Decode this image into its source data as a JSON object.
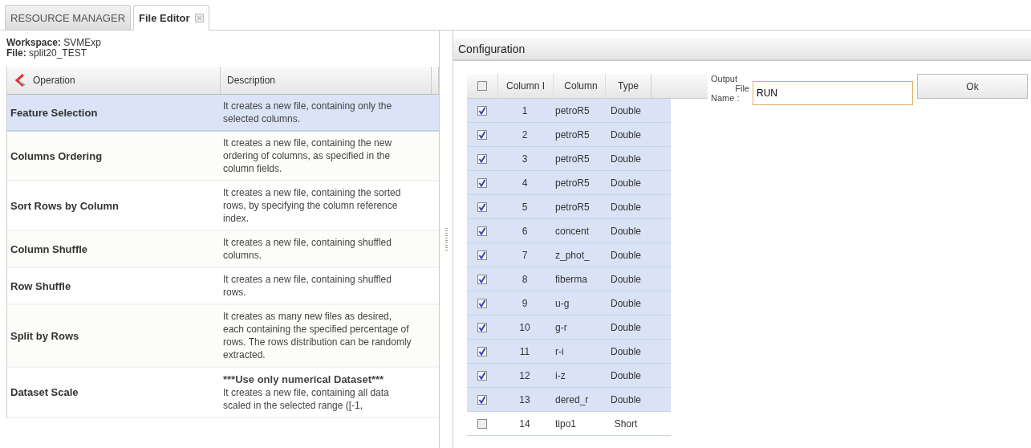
{
  "tabs": [
    {
      "label": "RESOURCE MANAGER",
      "selected": false,
      "closable": false
    },
    {
      "label": "File Editor",
      "selected": true,
      "closable": true
    }
  ],
  "info": [
    {
      "label": "Workspace:",
      "value": "SVMExp"
    },
    {
      "label": "File:",
      "value": "split20_TEST"
    }
  ],
  "operations": {
    "columns": [
      "Operation",
      "Description"
    ],
    "rows": [
      {
        "name": "Feature Selection",
        "description": "It creates a new file, containing only the selected columns.",
        "selected": true
      },
      {
        "name": "Columns Ordering",
        "description": "It creates a new file, containing the new ordering of columns, as specified in the column fields.",
        "selected": false
      },
      {
        "name": "Sort Rows by Column",
        "description": "It creates a new file, containing the sorted rows, by specifying the column reference index.",
        "selected": false
      },
      {
        "name": "Column Shuffle",
        "description": "It creates a new file, containing shuffled columns.",
        "selected": false
      },
      {
        "name": "Row Shuffle",
        "description": "It creates a new file, containing shuffled rows.",
        "selected": false
      },
      {
        "name": "Split by Rows",
        "description": "It creates as many new files as desired, each containing the specified percentage of rows. The rows distribution can be randomly extracted.",
        "selected": false
      },
      {
        "name": "Dataset Scale",
        "note": "***Use only numerical Dataset***",
        "description": "It creates a new file, containing all data scaled in the selected range ([-1,",
        "selected": false
      }
    ]
  },
  "configuration": {
    "title": "Configuration",
    "header_checked": false,
    "columns": [
      "Column I",
      "Column",
      "Type"
    ],
    "rows": [
      {
        "id": "1",
        "column": "petroR5",
        "type": "Double",
        "checked": true
      },
      {
        "id": "2",
        "column": "petroR5",
        "type": "Double",
        "checked": true
      },
      {
        "id": "3",
        "column": "petroR5",
        "type": "Double",
        "checked": true
      },
      {
        "id": "4",
        "column": "petroR5",
        "type": "Double",
        "checked": true
      },
      {
        "id": "5",
        "column": "petroR5",
        "type": "Double",
        "checked": true
      },
      {
        "id": "6",
        "column": "concent",
        "type": "Double",
        "checked": true
      },
      {
        "id": "7",
        "column": "z_phot_",
        "type": "Double",
        "checked": true
      },
      {
        "id": "8",
        "column": "fiberma",
        "type": "Double",
        "checked": true
      },
      {
        "id": "9",
        "column": "u-g",
        "type": "Double",
        "checked": true
      },
      {
        "id": "10",
        "column": "g-r",
        "type": "Double",
        "checked": true
      },
      {
        "id": "11",
        "column": "r-i",
        "type": "Double",
        "checked": true
      },
      {
        "id": "12",
        "column": "i-z",
        "type": "Double",
        "checked": true
      },
      {
        "id": "13",
        "column": "dered_r",
        "type": "Double",
        "checked": true
      },
      {
        "id": "14",
        "column": "tipo1",
        "type": "Short",
        "checked": false
      }
    ],
    "output_label": [
      "Output",
      "File",
      "Name :"
    ],
    "output_value": "RUN",
    "ok": "Ok"
  }
}
